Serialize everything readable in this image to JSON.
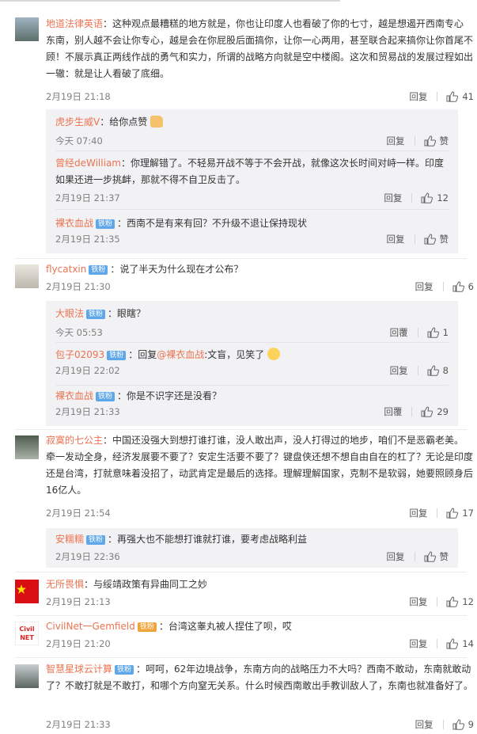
{
  "like_word": "赞",
  "c1": {
    "user": "地道法律英语",
    "text": "：这种观点最糟糕的地方就是，你也让印度人也看破了你的七寸，越是想遏开西南专心东南，别人越不会让你专心，越是会在你屁股后面搞你，让你一心两用，甚至联合起来搞你让你首尾不顾！不展示真正两线作战的勇气和实力，所谓的战略方向就是空中楼阁。这次和贸易战的发展过程如出一辙：就是让人看破了底细。",
    "time": "2月19日 21:18",
    "reply": "回复",
    "likes": "41",
    "replies": [
      {
        "user": "虎步生威V",
        "badge": "",
        "text": "：给你点赞",
        "time": "今天 07:40",
        "reply": "回复",
        "likes": "赞"
      },
      {
        "user": "曾经deWilliam",
        "badge": "",
        "text": "：你理解错了。不轻易开战不等于不会开战，就像这次长时间对峙一样。印度如果还进一步挑衅，那就不得不自卫反击了。",
        "time": "2月19日 21:37",
        "reply": "回复",
        "likes": "12"
      },
      {
        "user": "裸衣血战",
        "badge": "铁粉",
        "text": "：西南不是有来有回？不升级不退让保持现状",
        "time": "2月19日 21:35",
        "reply": "回复",
        "likes": "赞"
      }
    ]
  },
  "c2": {
    "user": "flycatxin",
    "badge": "铁粉",
    "text": "：说了半天为什么现在才公布？",
    "time": "2月19日 21:30",
    "reply": "回复",
    "likes": "6",
    "replies": [
      {
        "user": "大眼法",
        "badge": "铁粉",
        "text": "：眼瞎？",
        "time": "今天 05:53",
        "reply": "回覆",
        "likes": "1"
      },
      {
        "user": "包子02093",
        "badge": "铁粉",
        "text_pre": "：回复",
        "mention": "@裸衣血战",
        "text": ":文盲，见笑了",
        "time": "2月19日 22:02",
        "reply": "回复",
        "likes": "8"
      },
      {
        "user": "裸衣血战",
        "badge": "铁粉",
        "text": "：你是不识字还是没看？",
        "time": "2月19日 21:33",
        "reply": "回覆",
        "likes": "29"
      }
    ]
  },
  "c3": {
    "user": "寂寞的七公主",
    "text": "：中国还没强大到想打谁打谁，没人敢出声，没人打得过的地步，咱们不是恶霸老美。牵一发动全身，经济发展要不要了？安定生活要不要了？键盘侠还想不想自由自在的杠了？无论是印度还是台湾，打就意味着没招了，动武肯定是最后的选择。理解理解国家，克制不是软弱，她要照顾身后16亿人。",
    "time": "2月19日 21:54",
    "reply": "回复",
    "likes": "17",
    "replies": [
      {
        "user": "安糯糯",
        "badge": "铁粉",
        "text": "：再强大也不能想打谁就打谁，要考虑战略利益",
        "time": "2月19日 22:36",
        "reply": "回复",
        "likes": "赞"
      }
    ]
  },
  "c4": {
    "user": "无所畏惧",
    "text": "：与绥靖政策有异曲同工之妙",
    "time": "2月19日 21:13",
    "reply": "回复",
    "likes": "12"
  },
  "c5": {
    "user": "CivilNet一Gemfield",
    "badge": "铁粉",
    "text": "：台湾这睾丸被人捏住了呗，哎",
    "time": "2月19日 21:20",
    "reply": "回复",
    "likes": "14",
    "avatar_text": "Civil NET"
  },
  "c6": {
    "user": "智慧星球云计算",
    "badge": "铁粉",
    "text": "：呵呵，62年边境战争，东南方向的战略压力不大吗？西南不敢动，东南就敢动了？不敢打就是不敢打，和哪个方向窒无关系。什么时候西南敢出手教训敌人了，东南也就准备好了。",
    "time": "2月19日 21:33",
    "reply": "回复",
    "likes": "9"
  },
  "colors": {
    "username": "#eb7350",
    "badge": "#5ea7e8",
    "mention": "#eb7350",
    "meta": "#808080",
    "reply_bg": "#f2f2f5"
  }
}
